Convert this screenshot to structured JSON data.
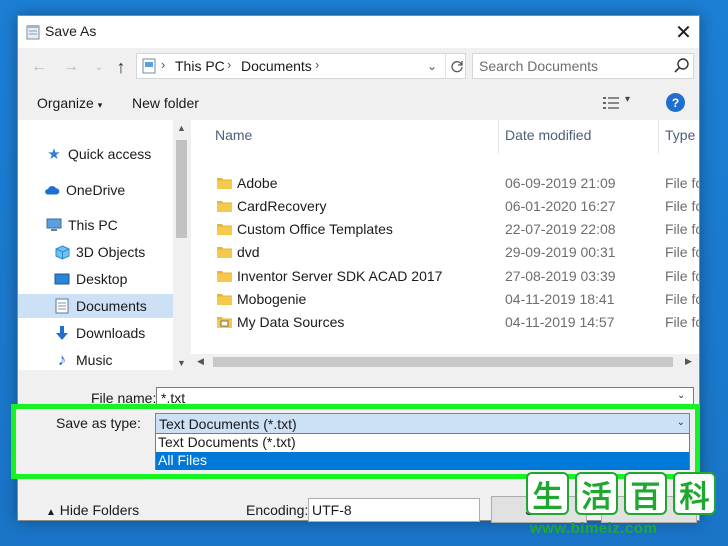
{
  "window": {
    "title": "Save As"
  },
  "address": {
    "crumbs": [
      "This PC",
      "Documents"
    ]
  },
  "search": {
    "placeholder": "Search Documents"
  },
  "toolbar": {
    "organize": "Organize",
    "new_folder": "New folder"
  },
  "nav": {
    "items": [
      {
        "label": "Quick access",
        "icon": "star-icon"
      },
      {
        "label": "OneDrive",
        "icon": "cloud-icon"
      },
      {
        "label": "This PC",
        "icon": "computer-icon"
      },
      {
        "label": "3D Objects",
        "icon": "cube-icon"
      },
      {
        "label": "Desktop",
        "icon": "desktop-icon"
      },
      {
        "label": "Documents",
        "icon": "documents-icon",
        "selected": true
      },
      {
        "label": "Downloads",
        "icon": "download-arrow-icon"
      },
      {
        "label": "Music",
        "icon": "music-note-icon"
      }
    ]
  },
  "files": {
    "headers": {
      "name": "Name",
      "date": "Date modified",
      "type": "Type"
    },
    "rows": [
      {
        "name": "Adobe",
        "date": "06-09-2019 21:09",
        "type": "File fo",
        "icon": "folder-icon"
      },
      {
        "name": "CardRecovery",
        "date": "06-01-2020 16:27",
        "type": "File fo",
        "icon": "folder-icon"
      },
      {
        "name": "Custom Office Templates",
        "date": "22-07-2019 22:08",
        "type": "File fo",
        "icon": "folder-icon"
      },
      {
        "name": "dvd",
        "date": "29-09-2019 00:31",
        "type": "File fo",
        "icon": "folder-icon"
      },
      {
        "name": "Inventor Server SDK ACAD 2017",
        "date": "27-08-2019 03:39",
        "type": "File fo",
        "icon": "folder-icon"
      },
      {
        "name": "Mobogenie",
        "date": "04-11-2019 18:41",
        "type": "File fo",
        "icon": "folder-icon"
      },
      {
        "name": "My Data Sources",
        "date": "04-11-2019 14:57",
        "type": "File fo",
        "icon": "data-sources-folder-icon"
      }
    ]
  },
  "form": {
    "filename_label": "File name:",
    "filename_value": "*.txt",
    "savetype_label": "Save as type:",
    "savetype_value": "Text Documents (*.txt)",
    "savetype_options": [
      "Text Documents (*.txt)",
      "All Files"
    ],
    "savetype_highlighted": "All Files",
    "hide_folders": "Hide Folders",
    "encoding_label": "Encoding:",
    "encoding_value": "UTF-8",
    "save_label": "Sav",
    "cancel_label": ""
  },
  "watermark": {
    "chars": [
      "生",
      "活",
      "百",
      "科"
    ],
    "url": "www.bimeiz.com"
  },
  "colors": {
    "highlight": "#17f222",
    "selection": "#0078d7",
    "nav_selected": "#cce0f6"
  }
}
